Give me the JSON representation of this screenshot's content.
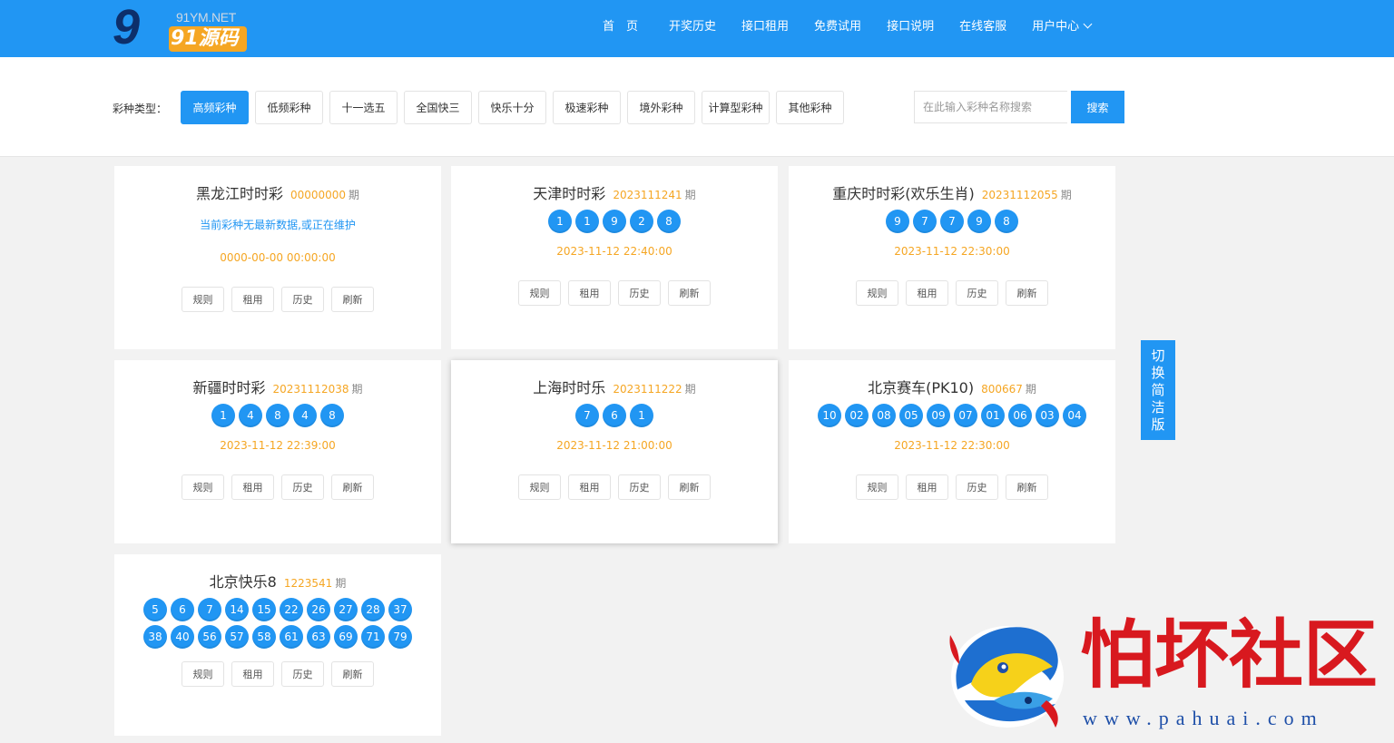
{
  "brand": {
    "logo_top": "91YM.NET",
    "logo_bottom": "91源码",
    "logo_digit": "9"
  },
  "nav": {
    "items": [
      "首　页",
      "开奖历史",
      "接口租用",
      "免费试用",
      "接口说明",
      "在线客服",
      "用户中心"
    ]
  },
  "filter": {
    "label": "彩种类型：",
    "types": [
      "高频彩种",
      "低频彩种",
      "十一选五",
      "全国快三",
      "快乐十分",
      "极速彩种",
      "境外彩种",
      "计算型彩种",
      "其他彩种"
    ],
    "active_index": 0,
    "search_placeholder": "在此输入彩种名称搜索",
    "search_button": "搜索"
  },
  "issue_suffix": "期",
  "actions": [
    "规则",
    "租用",
    "历史",
    "刷新"
  ],
  "cards": [
    {
      "name": "黑龙江时时彩",
      "issue": "00000000",
      "balls": [],
      "notice": "当前彩种无最新数据,或正在维护",
      "time": "0000-00-00 00:00:00"
    },
    {
      "name": "天津时时彩",
      "issue": "2023111241",
      "balls": [
        "1",
        "1",
        "9",
        "2",
        "8"
      ],
      "time": "2023-11-12 22:40:00"
    },
    {
      "name": "重庆时时彩(欢乐生肖)",
      "issue": "20231112055",
      "balls": [
        "9",
        "7",
        "7",
        "9",
        "8"
      ],
      "time": "2023-11-12 22:30:00"
    },
    {
      "name": "新疆时时彩",
      "issue": "20231112038",
      "balls": [
        "1",
        "4",
        "8",
        "4",
        "8"
      ],
      "time": "2023-11-12 22:39:00"
    },
    {
      "name": "上海时时乐",
      "issue": "2023111222",
      "balls": [
        "7",
        "6",
        "1"
      ],
      "time": "2023-11-12 21:00:00"
    },
    {
      "name": "北京赛车(PK10)",
      "issue": "800667",
      "balls": [
        "10",
        "02",
        "08",
        "05",
        "09",
        "07",
        "01",
        "06",
        "03",
        "04"
      ],
      "time": "2023-11-12 22:30:00"
    },
    {
      "name": "北京快乐8",
      "issue": "1223541",
      "balls": [
        "5",
        "6",
        "7",
        "14",
        "15",
        "22",
        "26",
        "27",
        "28",
        "37",
        "38",
        "40",
        "56",
        "57",
        "58",
        "61",
        "63",
        "69",
        "71",
        "79"
      ]
    }
  ],
  "switcher": [
    "切",
    "换",
    "简",
    "洁",
    "版"
  ],
  "watermark": {
    "title": "怕坏社区",
    "url": "www.pahuai.com"
  },
  "colors": {
    "primary": "#2196f3",
    "accent": "#f5a623",
    "watermark_red": "#d8191f"
  },
  "icons": {
    "user_menu": "chevron-down-icon",
    "watermark_logo": "fish-logo-icon"
  }
}
